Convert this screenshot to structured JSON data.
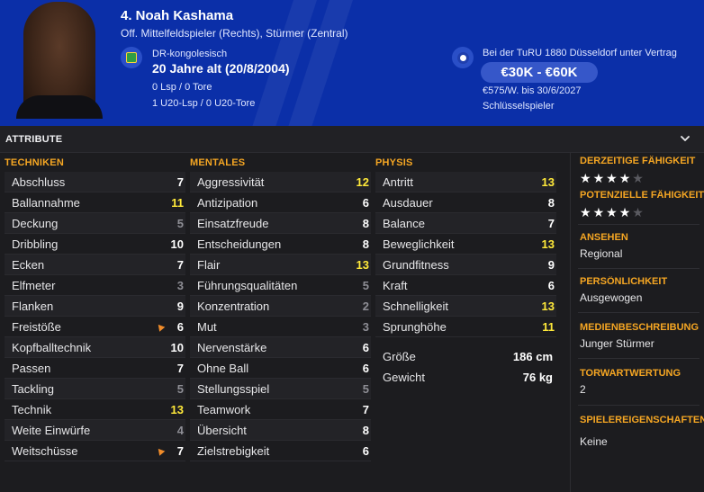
{
  "header": {
    "name": "4. Noah Kashama",
    "positions": "Off. Mittelfeldspieler (Rechts), Stürmer (Zentral)",
    "nationality": "DR-kongolesisch",
    "age": "20 Jahre alt (20/8/2004)",
    "caps": "0 Lsp / 0 Tore",
    "u20_caps": "1 U20-Lsp / 0 U20-Tore",
    "contract_status": "Bei der TuRU 1880 Düsseldorf unter Vertrag",
    "value": "€30K - €60K",
    "wage": "€575/W. bis 30/6/2027",
    "squad_role": "Schlüsselspieler",
    "header_color": "#0b2fa8"
  },
  "section": {
    "title": "ATTRIBUTE",
    "collapse_icon": "chevron-down-icon"
  },
  "columns": {
    "technical": {
      "title": "TECHNIKEN",
      "rows": [
        {
          "name": "Abschluss",
          "value": "7",
          "tier": "mid"
        },
        {
          "name": "Ballannahme",
          "value": "11",
          "tier": "hi"
        },
        {
          "name": "Deckung",
          "value": "5",
          "tier": "lo"
        },
        {
          "name": "Dribbling",
          "value": "10",
          "tier": "mid"
        },
        {
          "name": "Ecken",
          "value": "7",
          "tier": "mid"
        },
        {
          "name": "Elfmeter",
          "value": "3",
          "tier": "lo"
        },
        {
          "name": "Flanken",
          "value": "9",
          "tier": "mid"
        },
        {
          "name": "Freistöße",
          "value": "6",
          "tier": "mid",
          "trend": true
        },
        {
          "name": "Kopfballtechnik",
          "value": "10",
          "tier": "mid"
        },
        {
          "name": "Passen",
          "value": "7",
          "tier": "mid"
        },
        {
          "name": "Tackling",
          "value": "5",
          "tier": "lo"
        },
        {
          "name": "Technik",
          "value": "13",
          "tier": "hi"
        },
        {
          "name": "Weite Einwürfe",
          "value": "4",
          "tier": "lo"
        },
        {
          "name": "Weitschüsse",
          "value": "7",
          "tier": "mid",
          "trend": true
        }
      ]
    },
    "mental": {
      "title": "MENTALES",
      "rows": [
        {
          "name": "Aggressivität",
          "value": "12",
          "tier": "hi"
        },
        {
          "name": "Antizipation",
          "value": "6",
          "tier": "mid"
        },
        {
          "name": "Einsatzfreude",
          "value": "8",
          "tier": "mid"
        },
        {
          "name": "Entscheidungen",
          "value": "8",
          "tier": "mid"
        },
        {
          "name": "Flair",
          "value": "13",
          "tier": "hi"
        },
        {
          "name": "Führungsqualitäten",
          "value": "5",
          "tier": "lo"
        },
        {
          "name": "Konzentration",
          "value": "2",
          "tier": "lo"
        },
        {
          "name": "Mut",
          "value": "3",
          "tier": "lo"
        },
        {
          "name": "Nervenstärke",
          "value": "6",
          "tier": "mid"
        },
        {
          "name": "Ohne Ball",
          "value": "6",
          "tier": "mid"
        },
        {
          "name": "Stellungsspiel",
          "value": "5",
          "tier": "lo"
        },
        {
          "name": "Teamwork",
          "value": "7",
          "tier": "mid"
        },
        {
          "name": "Übersicht",
          "value": "8",
          "tier": "mid"
        },
        {
          "name": "Zielstrebigkeit",
          "value": "6",
          "tier": "mid"
        }
      ]
    },
    "physical": {
      "title": "PHYSIS",
      "rows": [
        {
          "name": "Antritt",
          "value": "13",
          "tier": "hi"
        },
        {
          "name": "Ausdauer",
          "value": "8",
          "tier": "mid"
        },
        {
          "name": "Balance",
          "value": "7",
          "tier": "mid"
        },
        {
          "name": "Beweglichkeit",
          "value": "13",
          "tier": "hi"
        },
        {
          "name": "Grundfitness",
          "value": "9",
          "tier": "mid"
        },
        {
          "name": "Kraft",
          "value": "6",
          "tier": "mid"
        },
        {
          "name": "Schnelligkeit",
          "value": "13",
          "tier": "hi"
        },
        {
          "name": "Sprunghöhe",
          "value": "11",
          "tier": "hi"
        }
      ],
      "meta": [
        {
          "name": "Größe",
          "value": "186 cm"
        },
        {
          "name": "Gewicht",
          "value": "76 kg"
        }
      ]
    }
  },
  "side": {
    "current_ability": {
      "label": "DERZEITIGE FÄHIGKEIT",
      "stars": 3.5,
      "max_stars": 5
    },
    "potential_ability": {
      "label": "POTENZIELLE FÄHIGKEIT",
      "stars": 4,
      "max_stars": 5
    },
    "reputation": {
      "label": "ANSEHEN",
      "value": "Regional"
    },
    "personality": {
      "label": "PERSÖNLICHKEIT",
      "value": "Ausgewogen"
    },
    "media": {
      "label": "MEDIENBESCHREIBUNG",
      "value": "Junger Stürmer"
    },
    "gk_rating": {
      "label": "TORWARTWERTUNG",
      "value": "2"
    },
    "player_traits": {
      "label": "SPIELEREIGENSCHAFTEN",
      "value": "Keine"
    }
  },
  "colors": {
    "accent": "#f5a623",
    "high_value": "#ffe93a",
    "low_value": "#8e8e95"
  }
}
